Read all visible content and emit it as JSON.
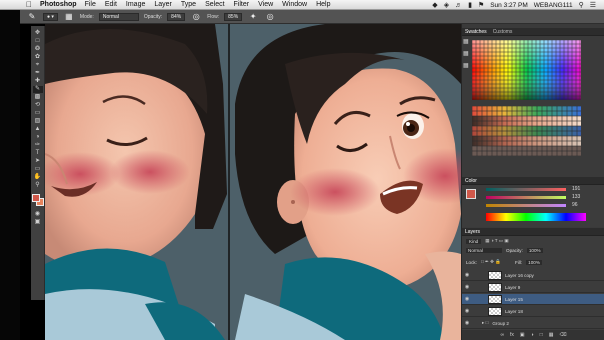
{
  "menubar": {
    "app_name": "Photoshop",
    "items": [
      "File",
      "Edit",
      "Image",
      "Layer",
      "Type",
      "Select",
      "Filter",
      "View",
      "Window",
      "Help"
    ],
    "clock": "Sun 3:27 PM",
    "user": "WEBANG111"
  },
  "options": {
    "mode_label": "Mode:",
    "mode_value": "Normal",
    "opacity_label": "Opacity:",
    "opacity_value": "84%",
    "flow_label": "Flow:",
    "flow_value": "85%"
  },
  "panels": {
    "swatches_tab": "Swatches",
    "custom_tab": "Customs",
    "color_tab": "Color",
    "color_values": [
      "191",
      "133",
      "96"
    ],
    "layers_tab": "Layers",
    "kind_label": "Kind",
    "blend_mode": "Normal",
    "opacity_label": "Opacity:",
    "opacity_value": "100%",
    "lock_label": "Lock:",
    "fill_label": "Fill:",
    "fill_value": "100%",
    "layers": [
      {
        "name": "Layer 16 copy"
      },
      {
        "name": "Layer 9"
      },
      {
        "name": "Layer 15"
      },
      {
        "name": "Layer 18"
      },
      {
        "name": "Group 2"
      }
    ]
  },
  "colors": {
    "foreground": "#d0584a",
    "background": "#e7835c",
    "canvas_bg": "#4d6069"
  }
}
